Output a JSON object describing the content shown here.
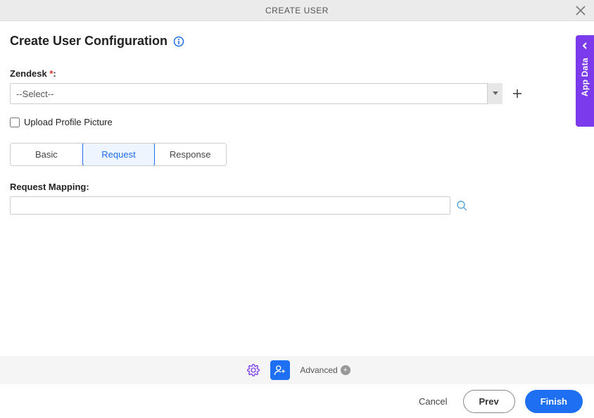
{
  "header": {
    "title": "CREATE USER"
  },
  "page": {
    "title": "Create User Configuration"
  },
  "zendesk": {
    "label_prefix": "Zendesk ",
    "label_suffix": ":",
    "placeholder": "--Select--"
  },
  "upload": {
    "label": "Upload Profile Picture"
  },
  "tabs": {
    "basic": "Basic",
    "request": "Request",
    "response": "Response"
  },
  "mapping": {
    "label": "Request Mapping:",
    "value": ""
  },
  "side": {
    "label": "App Data"
  },
  "toolbar": {
    "advanced": "Advanced"
  },
  "footer": {
    "cancel": "Cancel",
    "prev": "Prev",
    "finish": "Finish"
  }
}
